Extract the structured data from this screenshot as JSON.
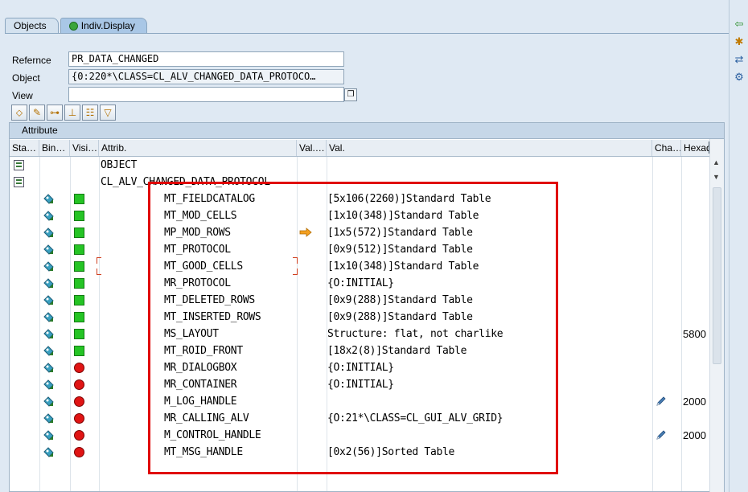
{
  "tabs": [
    {
      "label": "Objects",
      "active": false
    },
    {
      "label": "Indiv.Display",
      "active": true,
      "icon": "green-dot-icon"
    }
  ],
  "form": {
    "reference_label": "Refernce",
    "reference_value": "PR_DATA_CHANGED",
    "object_label": "Object",
    "object_value": "{0:220*\\CLASS=CL_ALV_CHANGED_DATA_PROTOCO…",
    "view_label": "View",
    "view_value": ""
  },
  "toolbar": {
    "buttons": [
      "tag-icon",
      "gear-pencil-icon",
      "hierarchy-icon",
      "collapse-icon",
      "layout-icon",
      "filter-icon"
    ]
  },
  "grid": {
    "title": "Attribute",
    "columns": [
      "Sta…",
      "Bin…",
      "Visi…",
      "Attrib.",
      "Val.…",
      "Val.",
      "Cha…",
      "Hexad"
    ],
    "rows": [
      {
        "type": "node",
        "vis": "",
        "attrib": "OBJECT",
        "valflag": "",
        "val": "",
        "cha": "",
        "hex": ""
      },
      {
        "type": "node",
        "vis": "",
        "attrib": "CL_ALV_CHANGED_DATA_PROTOCOL",
        "valflag": "",
        "val": "",
        "cha": "",
        "hex": ""
      },
      {
        "type": "leaf",
        "vis": "green",
        "attrib": "MT_FIELDCATALOG",
        "valflag": "",
        "val": "[5x106(2260)]Standard Table",
        "cha": "",
        "hex": ""
      },
      {
        "type": "leaf",
        "vis": "green",
        "attrib": "MT_MOD_CELLS",
        "valflag": "",
        "val": "[1x10(348)]Standard Table",
        "cha": "",
        "hex": ""
      },
      {
        "type": "leaf",
        "vis": "green",
        "attrib": "MP_MOD_ROWS",
        "valflag": "arrow",
        "val": "[1x5(572)]Standard Table",
        "cha": "",
        "hex": ""
      },
      {
        "type": "leaf",
        "vis": "green",
        "attrib": "MT_PROTOCOL",
        "valflag": "",
        "val": "[0x9(512)]Standard Table",
        "cha": "",
        "hex": ""
      },
      {
        "type": "leaf",
        "vis": "green",
        "attrib": "MT_GOOD_CELLS",
        "valflag": "",
        "val": "[1x10(348)]Standard Table",
        "cha": "",
        "hex": ""
      },
      {
        "type": "leaf",
        "vis": "green",
        "attrib": "MR_PROTOCOL",
        "valflag": "",
        "val": "{O:INITIAL}",
        "cha": "",
        "hex": ""
      },
      {
        "type": "leaf",
        "vis": "green",
        "attrib": "MT_DELETED_ROWS",
        "valflag": "",
        "val": "[0x9(288)]Standard Table",
        "cha": "",
        "hex": ""
      },
      {
        "type": "leaf",
        "vis": "green",
        "attrib": "MT_INSERTED_ROWS",
        "valflag": "",
        "val": "[0x9(288)]Standard Table",
        "cha": "",
        "hex": ""
      },
      {
        "type": "leaf",
        "vis": "green",
        "attrib": "MS_LAYOUT",
        "valflag": "",
        "val": "Structure: flat, not charlike",
        "cha": "",
        "hex": "5800"
      },
      {
        "type": "leaf",
        "vis": "green",
        "attrib": "MT_ROID_FRONT",
        "valflag": "",
        "val": "[18x2(8)]Standard Table",
        "cha": "",
        "hex": ""
      },
      {
        "type": "leaf",
        "vis": "red",
        "attrib": "MR_DIALOGBOX",
        "valflag": "",
        "val": "{O:INITIAL}",
        "cha": "",
        "hex": ""
      },
      {
        "type": "leaf",
        "vis": "red",
        "attrib": "MR_CONTAINER",
        "valflag": "",
        "val": "{O:INITIAL}",
        "cha": "",
        "hex": ""
      },
      {
        "type": "leaf",
        "vis": "red",
        "attrib": "M_LOG_HANDLE",
        "valflag": "",
        "val": "",
        "cha": "pencil",
        "hex": "2000"
      },
      {
        "type": "leaf",
        "vis": "red",
        "attrib": "MR_CALLING_ALV",
        "valflag": "",
        "val": "{O:21*\\CLASS=CL_GUI_ALV_GRID}",
        "cha": "",
        "hex": ""
      },
      {
        "type": "leaf",
        "vis": "red",
        "attrib": "M_CONTROL_HANDLE",
        "valflag": "",
        "val": "",
        "cha": "pencil",
        "hex": "2000"
      },
      {
        "type": "leaf",
        "vis": "red",
        "attrib": "MT_MSG_HANDLE",
        "valflag": "",
        "val": "[0x2(56)]Sorted Table",
        "cha": "",
        "hex": ""
      }
    ]
  },
  "colors": {
    "highlight": "#e00000",
    "vis_green": "#25c425",
    "vis_red": "#e01414"
  }
}
